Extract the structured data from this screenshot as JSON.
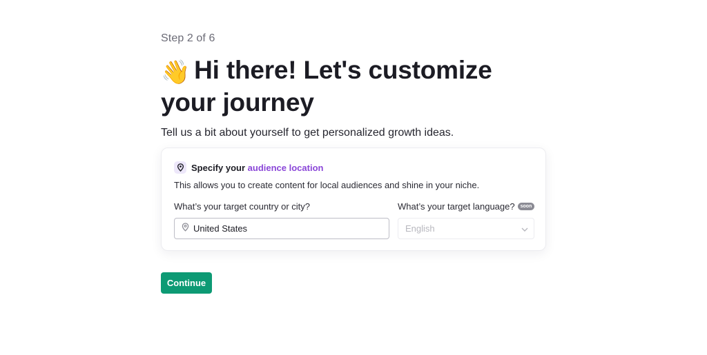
{
  "header": {
    "step": "Step 2 of 6",
    "wave_emoji": "👋",
    "title": "Hi there! Let's customize your journey",
    "subtitle": "Tell us a bit about yourself to get personalized growth ideas."
  },
  "card": {
    "icon": "location-pin-icon",
    "title_prefix": "Specify your",
    "title_accent": "audience location",
    "description": "This allows you to create content for local audiences and shine in your niche.",
    "country_label": "What’s your target country or city?",
    "country_value": "United States",
    "language_label": "What’s your target language?",
    "language_badge": "soon",
    "language_value": "English"
  },
  "actions": {
    "continue_label": "Continue"
  },
  "colors": {
    "accent": "#8a46d8",
    "primary_button": "#0d9a74"
  }
}
